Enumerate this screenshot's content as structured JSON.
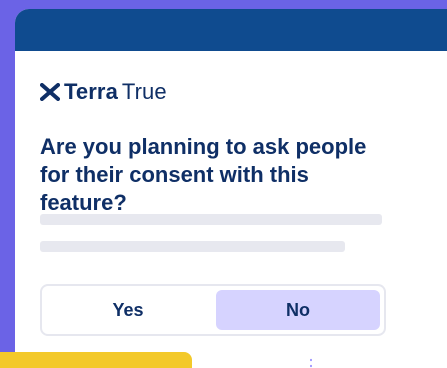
{
  "brand": {
    "logo_text_strong": "Terra",
    "logo_text_light": "True"
  },
  "main": {
    "question": "Are you planning to ask people for their consent with this feature?"
  },
  "choices": {
    "yes_label": "Yes",
    "no_label": "No",
    "selected": "No"
  },
  "icons": {
    "logo_mark": "terratrue-x-mark-icon",
    "connector": "dotted-connector-icon"
  },
  "colors": {
    "background_purple": "#6b63e6",
    "header_blue": "#0f4b8f",
    "text_navy": "#0f2f66",
    "selected_lavender": "#d6d3ff",
    "skeleton_gray": "#e7e8ef",
    "accent_yellow": "#f3c92a"
  }
}
